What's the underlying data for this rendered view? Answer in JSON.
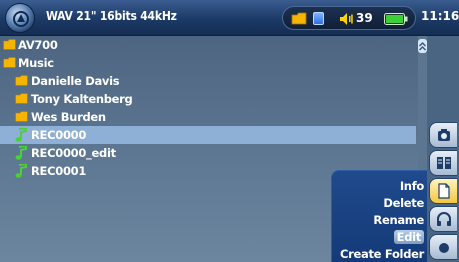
{
  "header": {
    "file_info": "WAV 21\" 16bits 44kHz",
    "volume": "39",
    "time": "11:16",
    "icons": [
      "archos-logo-icon",
      "folder-icon",
      "media-square-icon",
      "speaker-icon",
      "battery-icon"
    ]
  },
  "browser": {
    "items": [
      {
        "label": "AV700",
        "type": "folder"
      },
      {
        "label": "Music",
        "type": "folder"
      },
      {
        "label": "Danielle Davis",
        "type": "folder"
      },
      {
        "label": "Tony Kaltenberg",
        "type": "folder"
      },
      {
        "label": "Wes Burden",
        "type": "folder"
      },
      {
        "label": "REC0000",
        "type": "audio",
        "selected": true
      },
      {
        "label": "REC0000_edit",
        "type": "audio"
      },
      {
        "label": "REC0001",
        "type": "audio"
      }
    ]
  },
  "sidebar": {
    "buttons": [
      "camera-icon",
      "two-panels-icon",
      "file-icon",
      "headphones-icon",
      "record-icon"
    ],
    "active": "file-icon"
  },
  "context_menu": {
    "items": [
      "Info",
      "Delete",
      "Rename",
      "Edit",
      "Create Folder"
    ],
    "selected": "Edit"
  },
  "colors": {
    "selection": "#8fb0d6",
    "folder": "#f5b400",
    "audio_note": "#4ccf3a",
    "menu_bg": "#1b4485"
  }
}
